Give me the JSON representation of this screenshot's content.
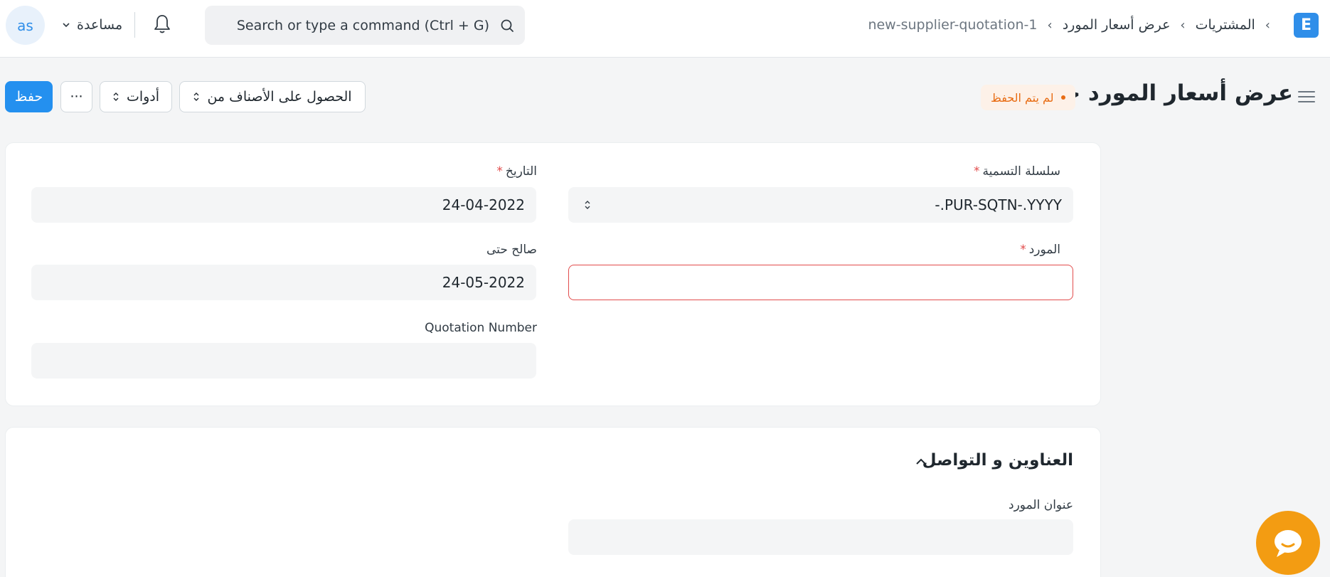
{
  "navbar": {
    "avatar_initials": "as",
    "help_label": "مساعدة",
    "search_placeholder": "Search or type a command (Ctrl + G)",
    "breadcrumbs": [
      "المشتريات",
      "عرض أسعار المورد",
      "new-supplier-quotation-1"
    ],
    "logo_letter": "E"
  },
  "page": {
    "title": "عرض أسعار المورد جديد",
    "status": "لم يتم الحفظ",
    "actions": {
      "get_items_label": "الحصول على الأصناف من",
      "tools_label": "أدوات",
      "more_label": "···",
      "save_label": "حفظ"
    }
  },
  "form": {
    "naming_series": {
      "label": "سلسلة التسمية",
      "value": "PUR-SQTN-.YYYY.-"
    },
    "date": {
      "label": "التاريخ",
      "value": "24-04-2022"
    },
    "supplier": {
      "label": "المورد",
      "value": ""
    },
    "valid_till": {
      "label": "صالح حتى",
      "value": "24-05-2022"
    },
    "quotation_number": {
      "label": "Quotation Number",
      "value": ""
    }
  },
  "address_section": {
    "title": "العناوين و التواصل",
    "supplier_address_label": "عنوان المورد"
  },
  "colors": {
    "primary": "#2490ef",
    "status": "#e86c13",
    "error": "#e24c4c",
    "chat": "#f39c12"
  },
  "icons": [
    "search-icon",
    "bell-icon",
    "chevron-down-icon",
    "hamburger-icon",
    "chevron-up-icon",
    "chat-icon"
  ]
}
